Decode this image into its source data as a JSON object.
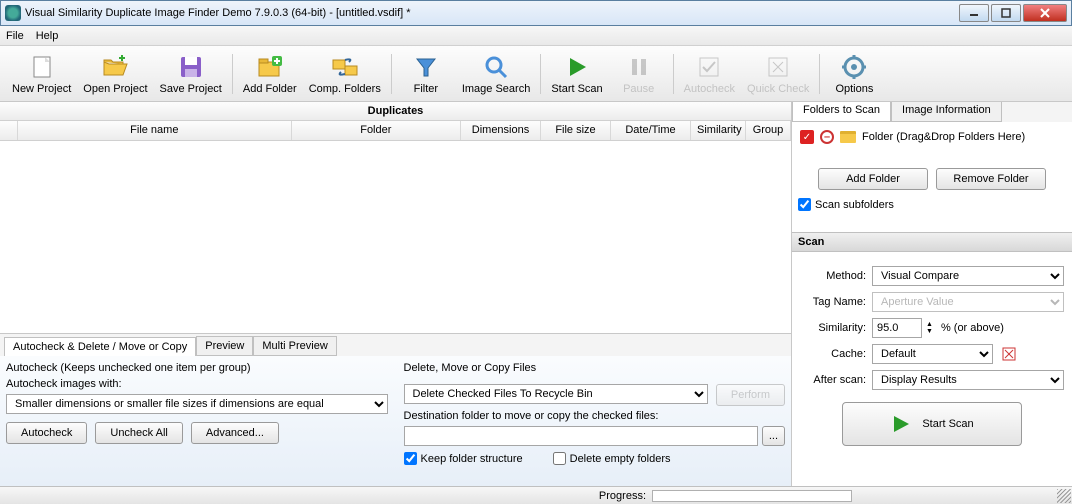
{
  "title": "Visual Similarity Duplicate Image Finder Demo 7.9.0.3 (64-bit) - [untitled.vsdif] *",
  "menu": {
    "file": "File",
    "help": "Help"
  },
  "toolbar": {
    "new_project": "New Project",
    "open_project": "Open Project",
    "save_project": "Save Project",
    "add_folder": "Add Folder",
    "comp_folders": "Comp. Folders",
    "filter": "Filter",
    "image_search": "Image Search",
    "start_scan": "Start Scan",
    "pause": "Pause",
    "autocheck": "Autocheck",
    "quick_check": "Quick Check",
    "options": "Options"
  },
  "dup": {
    "header": "Duplicates",
    "cols": {
      "filename": "File name",
      "folder": "Folder",
      "dimensions": "Dimensions",
      "filesize": "File size",
      "datetime": "Date/Time",
      "similarity": "Similarity",
      "group": "Group"
    }
  },
  "tabs": {
    "auto": "Autocheck & Delete / Move or Copy",
    "preview": "Preview",
    "multi": "Multi Preview"
  },
  "autocheck": {
    "desc": "Autocheck (Keeps unchecked one item per group)",
    "with_label": "Autocheck images with:",
    "criterion": "Smaller dimensions or smaller file sizes if dimensions are equal",
    "btn_autocheck": "Autocheck",
    "btn_uncheck": "Uncheck All",
    "btn_advanced": "Advanced..."
  },
  "delmove": {
    "title": "Delete, Move or Copy Files",
    "action": "Delete Checked Files To Recycle Bin",
    "perform": "Perform",
    "dest_label": "Destination folder to move or copy the checked files:",
    "dest_value": "",
    "keep_structure": "Keep folder structure",
    "delete_empty": "Delete empty folders"
  },
  "right": {
    "tab_folders": "Folders to Scan",
    "tab_info": "Image Information",
    "folder_placeholder": "Folder (Drag&Drop Folders Here)",
    "add_folder": "Add Folder",
    "remove_folder": "Remove Folder",
    "scan_subfolders": "Scan subfolders"
  },
  "scan": {
    "header": "Scan",
    "method_label": "Method:",
    "method_value": "Visual Compare",
    "tag_label": "Tag Name:",
    "tag_value": "Aperture Value",
    "sim_label": "Similarity:",
    "sim_value": "95.0",
    "sim_suffix": "%   (or above)",
    "cache_label": "Cache:",
    "cache_value": "Default",
    "after_label": "After scan:",
    "after_value": "Display Results",
    "start_btn": "Start Scan"
  },
  "progress": {
    "label": "Progress:"
  }
}
